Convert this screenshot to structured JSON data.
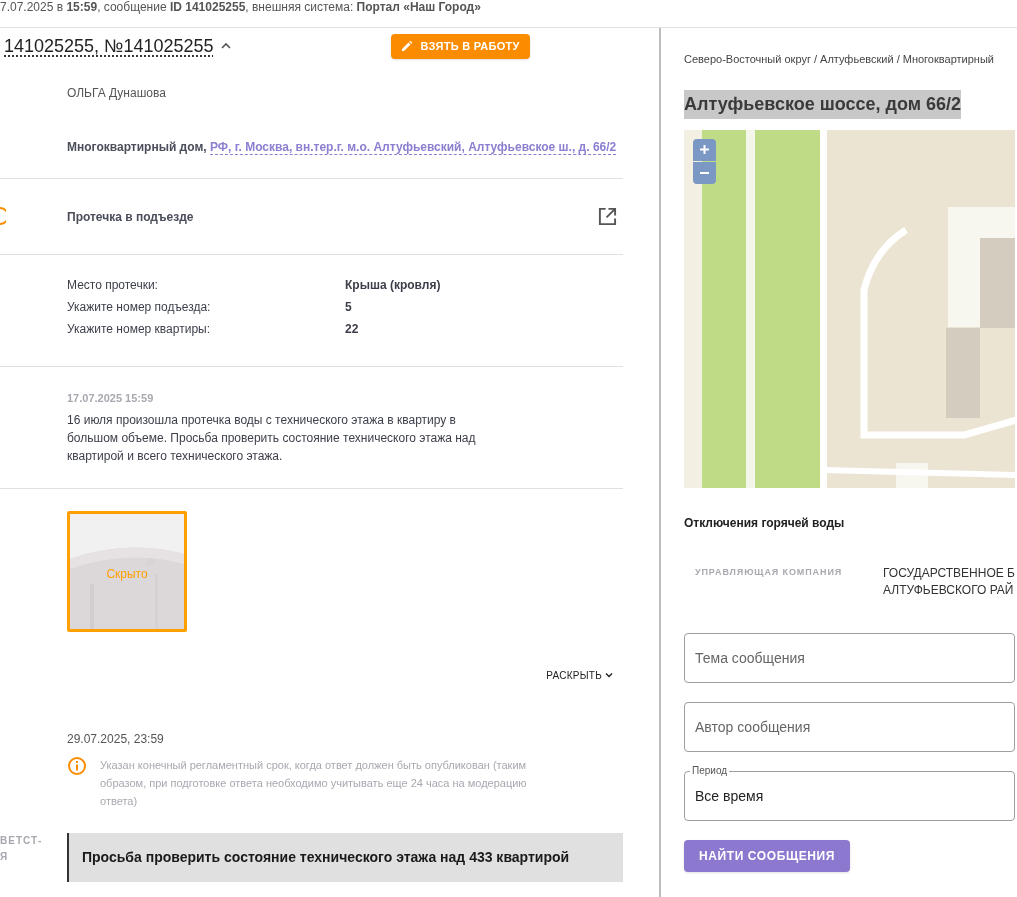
{
  "header": {
    "info": "7.07.2025 в **15:59**, сообщение **ID 141025255**, внешняя система: **Портал «Наш Город»**"
  },
  "request": {
    "title": "141025255, №141025255",
    "expanded": true,
    "take_button": "ВЗЯТЬ В РАБОТУ",
    "author": "ОЛЬГА Дунашова",
    "object_type": "Многоквартирный дом,",
    "address": "РФ, г. Москва, вн.тер.г. м.о. Алтуфьевский, Алтуфьевское ш., д. 66/2",
    "category": "Протечка в подъезде",
    "fields": [
      {
        "label": "Место протечки:",
        "value": "Крыша (кровля)"
      },
      {
        "label": "Укажите номер подъезда:",
        "value": "5"
      },
      {
        "label": "Укажите номер квартиры:",
        "value": "22"
      }
    ],
    "message_date": "17.07.2025 15:59",
    "message_text": "16 июля произошла протечка воды с технического этажа в квартиру в большом объеме. Просьба проверить состояние технического этажа над квартирой и всего технического этажа.",
    "photos": [
      {
        "kind": "picture",
        "caption": "Скрыто"
      }
    ],
    "expand_button": "РАСКРЫТЬ",
    "deadline": "29.07.2025, 23:59",
    "deadline_note": "Указан конечный регламентный срок, когда ответ должен быть опубликован (таким образом, при подготовке ответа необходимо учитывать еще 24 часа на модерацию ответа)",
    "answer_label": "ВЕТСТ-\nЯ",
    "answer_text": "Просьба проверить состояние технического этажа над 433 квартирой"
  },
  "sidebar": {
    "breadcrumb": "Северо-Восточный округ / Алтуфьевский / Многоквартирный",
    "address_title": "Алтуфьевское шоссе, дом 66/2",
    "hot_water": "Отключения горячей воды",
    "company_label": "УПРАВЛЯЮЩАЯ КОМПАНИЯ",
    "company_name": "ГОСУДАРСТВЕННОЕ Б\nАЛТУФЬЕВСКОГО РАЙ",
    "filters": [
      {
        "kind": "text",
        "placeholder": "Тема сообщения"
      },
      {
        "kind": "text",
        "placeholder": "Автор сообщения"
      },
      {
        "kind": "select",
        "label": "Период",
        "value": "Все время"
      }
    ],
    "search_button": "НАЙТИ СООБЩЕНИЯ"
  }
}
